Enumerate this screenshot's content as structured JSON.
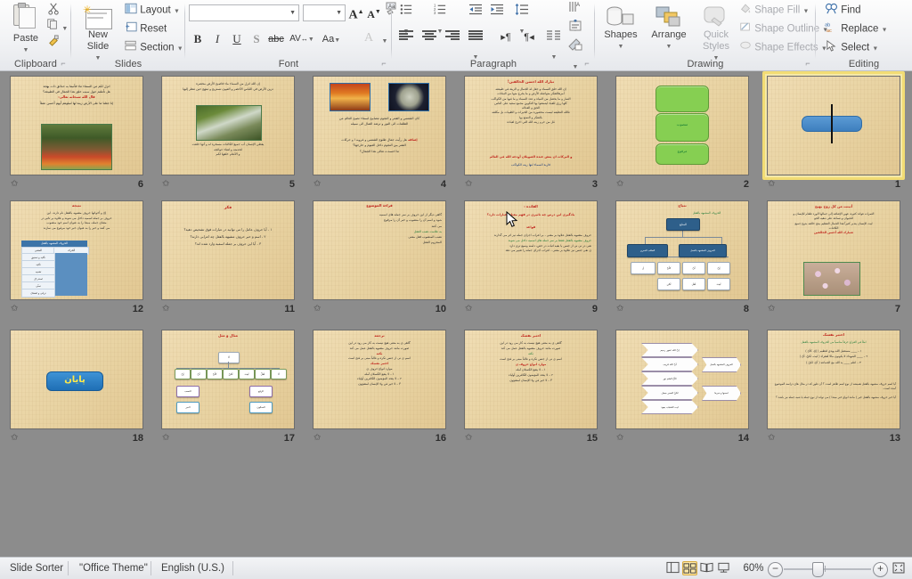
{
  "app": {
    "name": "Microsoft PowerPoint",
    "view": "Slide Sorter"
  },
  "ribbon": {
    "groups": [
      {
        "id": "clipboard",
        "label": "Clipboard"
      },
      {
        "id": "slides",
        "label": "Slides"
      },
      {
        "id": "font",
        "label": "Font"
      },
      {
        "id": "paragraph",
        "label": "Paragraph"
      },
      {
        "id": "drawing",
        "label": "Drawing"
      },
      {
        "id": "editing",
        "label": "Editing"
      }
    ],
    "clipboard": {
      "paste_label": "Paste",
      "cut_icon": "scissors-icon",
      "copy_icon": "copy-icon",
      "format_painter_icon": "format-painter-icon"
    },
    "slides": {
      "new_slide_label_line1": "New",
      "new_slide_label_line2": "Slide",
      "layout_label": "Layout",
      "reset_label": "Reset",
      "section_label": "Section"
    },
    "font": {
      "font_name_value": "",
      "font_size_value": "",
      "grow_font": "A",
      "shrink_font": "A",
      "clear_formatting_icon": "clear-formatting-icon",
      "bold": "B",
      "italic": "I",
      "underline": "U",
      "shadow": "S",
      "strikethrough": "abc",
      "character_spacing": "AV",
      "change_case": "Aa",
      "font_color": "A"
    },
    "paragraph": {
      "bullets_icon": "bullets-icon",
      "numbering_icon": "numbering-icon",
      "decrease_indent_icon": "decrease-indent-icon",
      "increase_indent_icon": "increase-indent-icon",
      "line_spacing_icon": "line-spacing-icon",
      "text_direction_icon": "text-direction-icon",
      "align_text_icon": "align-text-icon",
      "convert_smartart_icon": "convert-to-smartart-icon",
      "align_left_icon": "align-left-icon",
      "align_center_icon": "align-center-icon",
      "align_right_icon": "align-right-icon",
      "justify_icon": "justify-icon",
      "ltr_icon": "left-to-right-icon",
      "rtl_icon": "right-to-left-icon",
      "columns_icon": "columns-icon"
    },
    "drawing": {
      "shapes_label": "Shapes",
      "arrange_label": "Arrange",
      "quick_styles_line1": "Quick",
      "quick_styles_line2": "Styles",
      "shape_fill_label": "Shape Fill",
      "shape_outline_label": "Shape Outline",
      "shape_effects_label": "Shape Effects"
    },
    "editing": {
      "find_label": "Find",
      "replace_label": "Replace",
      "select_label": "Select"
    }
  },
  "status_bar": {
    "view_name": "Slide Sorter",
    "theme_name": "\"Office Theme\"",
    "language": "English (U.S.)",
    "zoom_level": "60%",
    "view_buttons": [
      {
        "name": "normal-view",
        "active": false
      },
      {
        "name": "slide-sorter-view",
        "active": true
      },
      {
        "name": "reading-view",
        "active": false
      },
      {
        "name": "slide-show-view",
        "active": false
      }
    ],
    "zoom_out_label": "−",
    "zoom_in_label": "+",
    "fit_to_window_name": "fit-slide-to-window-button"
  },
  "slides": [
    {
      "number": "1",
      "selected": true,
      "kind": "shape",
      "has_transition_star": true,
      "description": "Blue rounded rectangle with black text cursor"
    },
    {
      "number": "2",
      "selected": false,
      "kind": "green-boxes",
      "has_transition_star": true,
      "boxes": [
        "",
        "منصوب",
        "مرفوع"
      ],
      "description": "Three green rounded rectangles"
    },
    {
      "number": "3",
      "selected": false,
      "kind": "text",
      "has_transition_star": true,
      "title": "تبارك الله احسن الخالقين!",
      "lines": [
        "إن الله خلق السماء و جعل له الجمال و الزينة في طبيعته",
        "أمرهالتفكر متواصله الأرض و ما يخرج منها من النباتات",
        "الثمار و ما يحصل من المياه و عدد السماء و ما فيها من الكواكب",
        "كلها رزق للعباد ليتمتعوا بها التكوين مجمع سعيد على الناس",
        "الحق و العداله",
        "فالله النظيفه ليست محصوره من الخيرات و الطيبات بل مكلفه",
        "بالتفكر و التمتع بها",
        "قل من حرم زينه الله التي اخرج لعباده"
      ],
      "footer_red": "و البركات ان يعض عنده الصويلان أودعه الله في العالم",
      "footer_dark": "فاربة السماء لنها زينه الكواكب"
    },
    {
      "number": "4",
      "selected": false,
      "kind": "two-images",
      "has_transition_star": true,
      "image_left": "sunset-photo",
      "image_right": "moon-photo",
      "lines": [
        "كان الشمس و القمر و النجوم مصابيح لسماء تصبح العالم من",
        "الظلمات الى النور و ترشد الضال الى سبيله"
      ],
      "question_label": "إضافه",
      "questions": [
        "هل رأيت جمال طلوع الشمس و غروبه ا و حركات",
        "القمر بين النجوم داخل العيوم و خارجها؟",
        "ما احسدت تعالى هذا الجمال؟"
      ]
    },
    {
      "number": "5",
      "selected": false,
      "kind": "one-image",
      "has_transition_star": true,
      "image": "stream-forest-photo",
      "lines": [
        "إن الله انزل من السماء ماء فاصبح الأرض مخضرة",
        "تزين الأرض في اللباس الأخضر و العيون تستريح و تبتهج حين تنظر إليها",
        "يعطي الإنسان أب جميع الكائنات مسخره له و أنها خلقت",
        "لخدمته و لفناء حوائجه",
        "و الأنعام خلقها لكم"
      ]
    },
    {
      "number": "6",
      "selected": false,
      "kind": "one-image",
      "has_transition_star": true,
      "image": "garden-flowers-photo",
      "lines": [
        "انزل لكم من السماء ماء فأنبتنا به حدائق ذات بهجة",
        "هل تأملتم حول سبب خلق هذا الجمال في الطبيعة؟"
      ],
      "highlight": "قال الله سبحانه تعالى:",
      "verse": "إنا جعلنا ما على الأرض زينة لها لنبلوهم أيهم أحسن عملاً"
    },
    {
      "number": "7",
      "selected": false,
      "kind": "one-image",
      "has_transition_star": true,
      "image": "blossom-photo",
      "title": "أنبتت من كل زوج بهيج",
      "lines": [
        "الثمرات فوائد كثيره، فهي الإضافه إلى جمالها الورد طعام للإنسان و",
        "للحيوان و تساعد على تنقيه الجو",
        "ليت الإنسان يتدبر كثيراً هذا الجمال العظيم ينتج خالقه بدوع جميع",
        "الكائنات"
      ],
      "red_quote": "فتبارك الله أحسن الخالقين"
    },
    {
      "number": "8",
      "selected": false,
      "kind": "org-chart",
      "has_transition_star": true,
      "title": "نتياج",
      "subtitle": "الحروف المشبهه بالفعل",
      "root": "المنابع",
      "level2": [
        "الحروف المشبهه بالفعل",
        "الطلب الخبري"
      ],
      "level3": [
        "إنّ",
        "أنّ",
        "كأنّ",
        "ل"
      ],
      "level4": [
        "ليت",
        "لعل",
        "لكن"
      ]
    },
    {
      "number": "9",
      "selected": false,
      "kind": "bullets",
      "has_transition_star": true,
      "has_mouse_cursor": true,
      "title": "الفائدة :",
      "subtitle": "يادگیری این درس چه تاثیری در فهم معنای عبارات دارد؟",
      "sub2": "قواعد",
      "bullets": [
        "حروف مشبهه بالفعل علاوه بر معنی ، بر اعراب اجزای جمله نیز اثر می گذارند",
        "حروف مشبهه بالفعل فقط بر سر جمله های اسمیه داخل می شوند",
        "نفی در نی نی از جنس با بقیه اثبات در خص، دامنه وسیع تری دارد",
        "ی نفی جنس نیز علاوه بر معنی ، اعراب اجزای جمله را تغییر می دهد"
      ]
    },
    {
      "number": "10",
      "selected": false,
      "kind": "text",
      "has_transition_star": true,
      "title": "قراءة الموضوع",
      "lines": [
        "گاهی دیگر از این حروف بر سر جمله های اسمیه",
        "شود و اسم آن را منصوب و خبر آن را مرفوع",
        "می کنند",
        "به علامت نصب الفعل",
        "نصب المنصوب فعل معنی",
        "المجزوم الفعل"
      ]
    },
    {
      "number": "11",
      "selected": false,
      "kind": "questions",
      "has_transition_star": true,
      "title": "فکر",
      "questions": [
        "۱ - آیا حروف عامل را می توانید در عبارات فوق تشخیص دهید؟",
        "۲ - اسم و خبر حروف مشبهه بالفعل چه اعرابی دارند؟",
        "۳ - آیا این حروف بر جمله اسمیه وارد شده اند؟"
      ]
    },
    {
      "number": "12",
      "selected": false,
      "kind": "table",
      "has_transition_star": true,
      "title": "نتیجه",
      "lines": [
        "إنّ و أخواتها حروف مشبهه بالفعل نام دارند. این",
        "حروف بر جمله اسمیه داخل می شوند و علاوه بر تاثیر در",
        "معنای جمله، مبتدا را به عنوان اسم خود منصوب",
        "می کنند و خبر را به عنوان خبر خود مرفوع می سازند"
      ],
      "table": {
        "header": "الحروف المشبهه بالفعل",
        "columns": [
          "المعنى",
          "الحرف"
        ],
        "rows": [
          [
            "تأکید و تحقیق",
            "إنّ"
          ],
          [
            "تأکید",
            "أنّ"
          ],
          [
            "تشبیه",
            "کأنّ"
          ],
          [
            "استدراک",
            "لکنّ"
          ],
          [
            "تمنّی",
            "ليت"
          ],
          [
            "ترجّی و اشفاق",
            "لعلّ"
          ]
        ]
      }
    },
    {
      "number": "13",
      "selected": false,
      "kind": "exercise",
      "has_transition_star": true,
      "title": "اختبر نفسک",
      "lines": [
        "املأ في الفراغ حرفاً مناسباً من الحروف المشبهه بالفعل",
        "۱ – ____ مستقبل الله يهدي لعظيم   ( إنّ، كأنّ )",
        "۲ – ____ الشهداء لا يكونون مالا لفقراء   ( ليت، لكنّ، أنّ )",
        "۳ – اعلم ____ يد الله مع الجماعه   ( أنّ، لكنّ )"
      ],
      "bullets": [
        "آیا اسم حروف مشبهه بالفعل همیشه از نوع اسم ظاهر است ؟ آن طور که در مثال های دراسه الموضوع آمده است.",
        "آیا خبر حروف مشبهه بالفعل خیر ( مانند انواع خبر مبتدا ) می تواند از نوع جمله یا شبه جمله نیز باشد ؟"
      ]
    },
    {
      "number": "14",
      "selected": false,
      "kind": "chevrons",
      "has_transition_star": true,
      "chevrons": [
        "إنّ الله غفور رحيم",
        "أنّ الله قريب",
        "كأنّ العلم نور",
        "لكنّ الصبر جميل",
        "ليت الشباب يعود"
      ],
      "side_labels": [
        "الحروف المشبهه بالفعل",
        "اسمها و خبرها"
      ]
    },
    {
      "number": "15",
      "selected": false,
      "kind": "text",
      "has_transition_star": true,
      "title": "ترجمه",
      "title2": "اختبر نفسک",
      "lines": [
        "گاهی ی به معنی هیچ نیست به کار می رود در این",
        "صورت مانند حروف مشبهه بالفعل عمل می کند",
        "نکته",
        "اسم ی نی از جنس نکره و غالباً مبنی بر فتح است",
        "موارد انواع حروف ی",
        "۱ – لا ينفع الكسلان آمله",
        "۲ – لا يتحد المؤمنون الكافرين أولياء",
        "۳ – لا خير في ودّ الإنسان لمشؤون"
      ]
    },
    {
      "number": "16",
      "selected": false,
      "kind": "text",
      "has_transition_star": true,
      "title": "ترجمه"
    },
    {
      "number": "17",
      "selected": false,
      "kind": "diagram",
      "has_transition_star": true,
      "title": "مثال و مثل",
      "root": "لا",
      "nodes": [
        "إنّ",
        "أنّ",
        "كأنّ",
        "لكنّ",
        "ليت",
        "لعلّ",
        "لا"
      ],
      "leaves": [
        "النصب",
        "الرفع",
        "الجر",
        "السكون"
      ]
    },
    {
      "number": "18",
      "selected": false,
      "kind": "end",
      "has_transition_star": true,
      "end_label": "پایان"
    }
  ]
}
